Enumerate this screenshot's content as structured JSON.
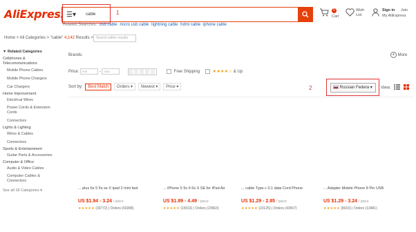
{
  "header": {
    "logo": "AliExpress",
    "search_value": "cable",
    "cart_label": "Cart",
    "cart_count": "0",
    "wishlist_label": "Wish List",
    "signin_label": "Sign in",
    "join_label": "Join",
    "account_label": "My AliExpress",
    "annotation_1": "1"
  },
  "related": {
    "label": "Related Searches:",
    "items": [
      "usb cable",
      "micro usb cable",
      "lightning cable",
      "hdmi cable",
      "iphone cable"
    ]
  },
  "breadcrumb": {
    "text": "Home > All Categories > \"cable\"",
    "count": "4,142",
    "suffix": "Results >",
    "within_placeholder": "Search within results"
  },
  "sidebar": {
    "heading": "▼ Related Categories",
    "groups": [
      {
        "title": "Cellphones & Telecommunications",
        "items": [
          "Mobile Phone Cables",
          "Mobile Phone Chargers",
          "Car Chargers"
        ]
      },
      {
        "title": "Home Improvement",
        "items": [
          "Electrical Wires",
          "Power Cords & Extension Cords",
          "Connectors"
        ]
      },
      {
        "title": "Lights & Lighting",
        "items": [
          "Wires & Cables",
          "Connectors"
        ]
      },
      {
        "title": "Sports & Entertainment",
        "items": [
          "Guitar Parts & Accessories"
        ]
      },
      {
        "title": "Computer & Office",
        "items": [
          "Audio & Video Cables",
          "Computer Cables & Connectors"
        ]
      }
    ],
    "see_all": "See all 18 Categories ▾"
  },
  "filters": {
    "brands_label": "Brands:",
    "more_label": "More",
    "price_label": "Price:",
    "price_min": "min",
    "price_max": "max",
    "free_shipping": "Free Shipping",
    "rating_suffix": "& Up"
  },
  "sort": {
    "label": "Sort by:",
    "options": [
      "Best Match",
      "Orders ▾",
      "Newest ▾",
      "Price ▾"
    ]
  },
  "ship_to": {
    "country": "Russian Federa ▾",
    "annotation_2": "2"
  },
  "view_label": "View:",
  "products": [
    {
      "title": "... plus 6s 5 5s se X ipad 2 mini fast",
      "price": "US $1.94 - 3.24",
      "unit": "/ piece",
      "reviews": "(33772)",
      "orders": "Orders (60288)"
    },
    {
      "title": "... iPhone 5 5s 6 6s X SE for iPad Air",
      "price": "US $1.89 - 4.49",
      "unit": "/ piece",
      "reviews": "(15516)",
      "orders": "Orders (23963)"
    },
    {
      "title": "... cable Type c 3.1 data Cord Phone",
      "price": "US $1.29 - 2.85",
      "unit": "/ piece",
      "reviews": "(23125)",
      "orders": "Orders (43567)"
    },
    {
      "title": "... Adapter Mobile Phone 8 Pin USB",
      "price": "US $1.29 - 3.24",
      "unit": "/ piece",
      "reviews": "(8010)",
      "orders": "Orders (13481)"
    }
  ],
  "colors": {
    "accent": "#e62e04",
    "annotation": "#e03030",
    "link": "#1a5fb4",
    "star": "#f29b0c"
  }
}
